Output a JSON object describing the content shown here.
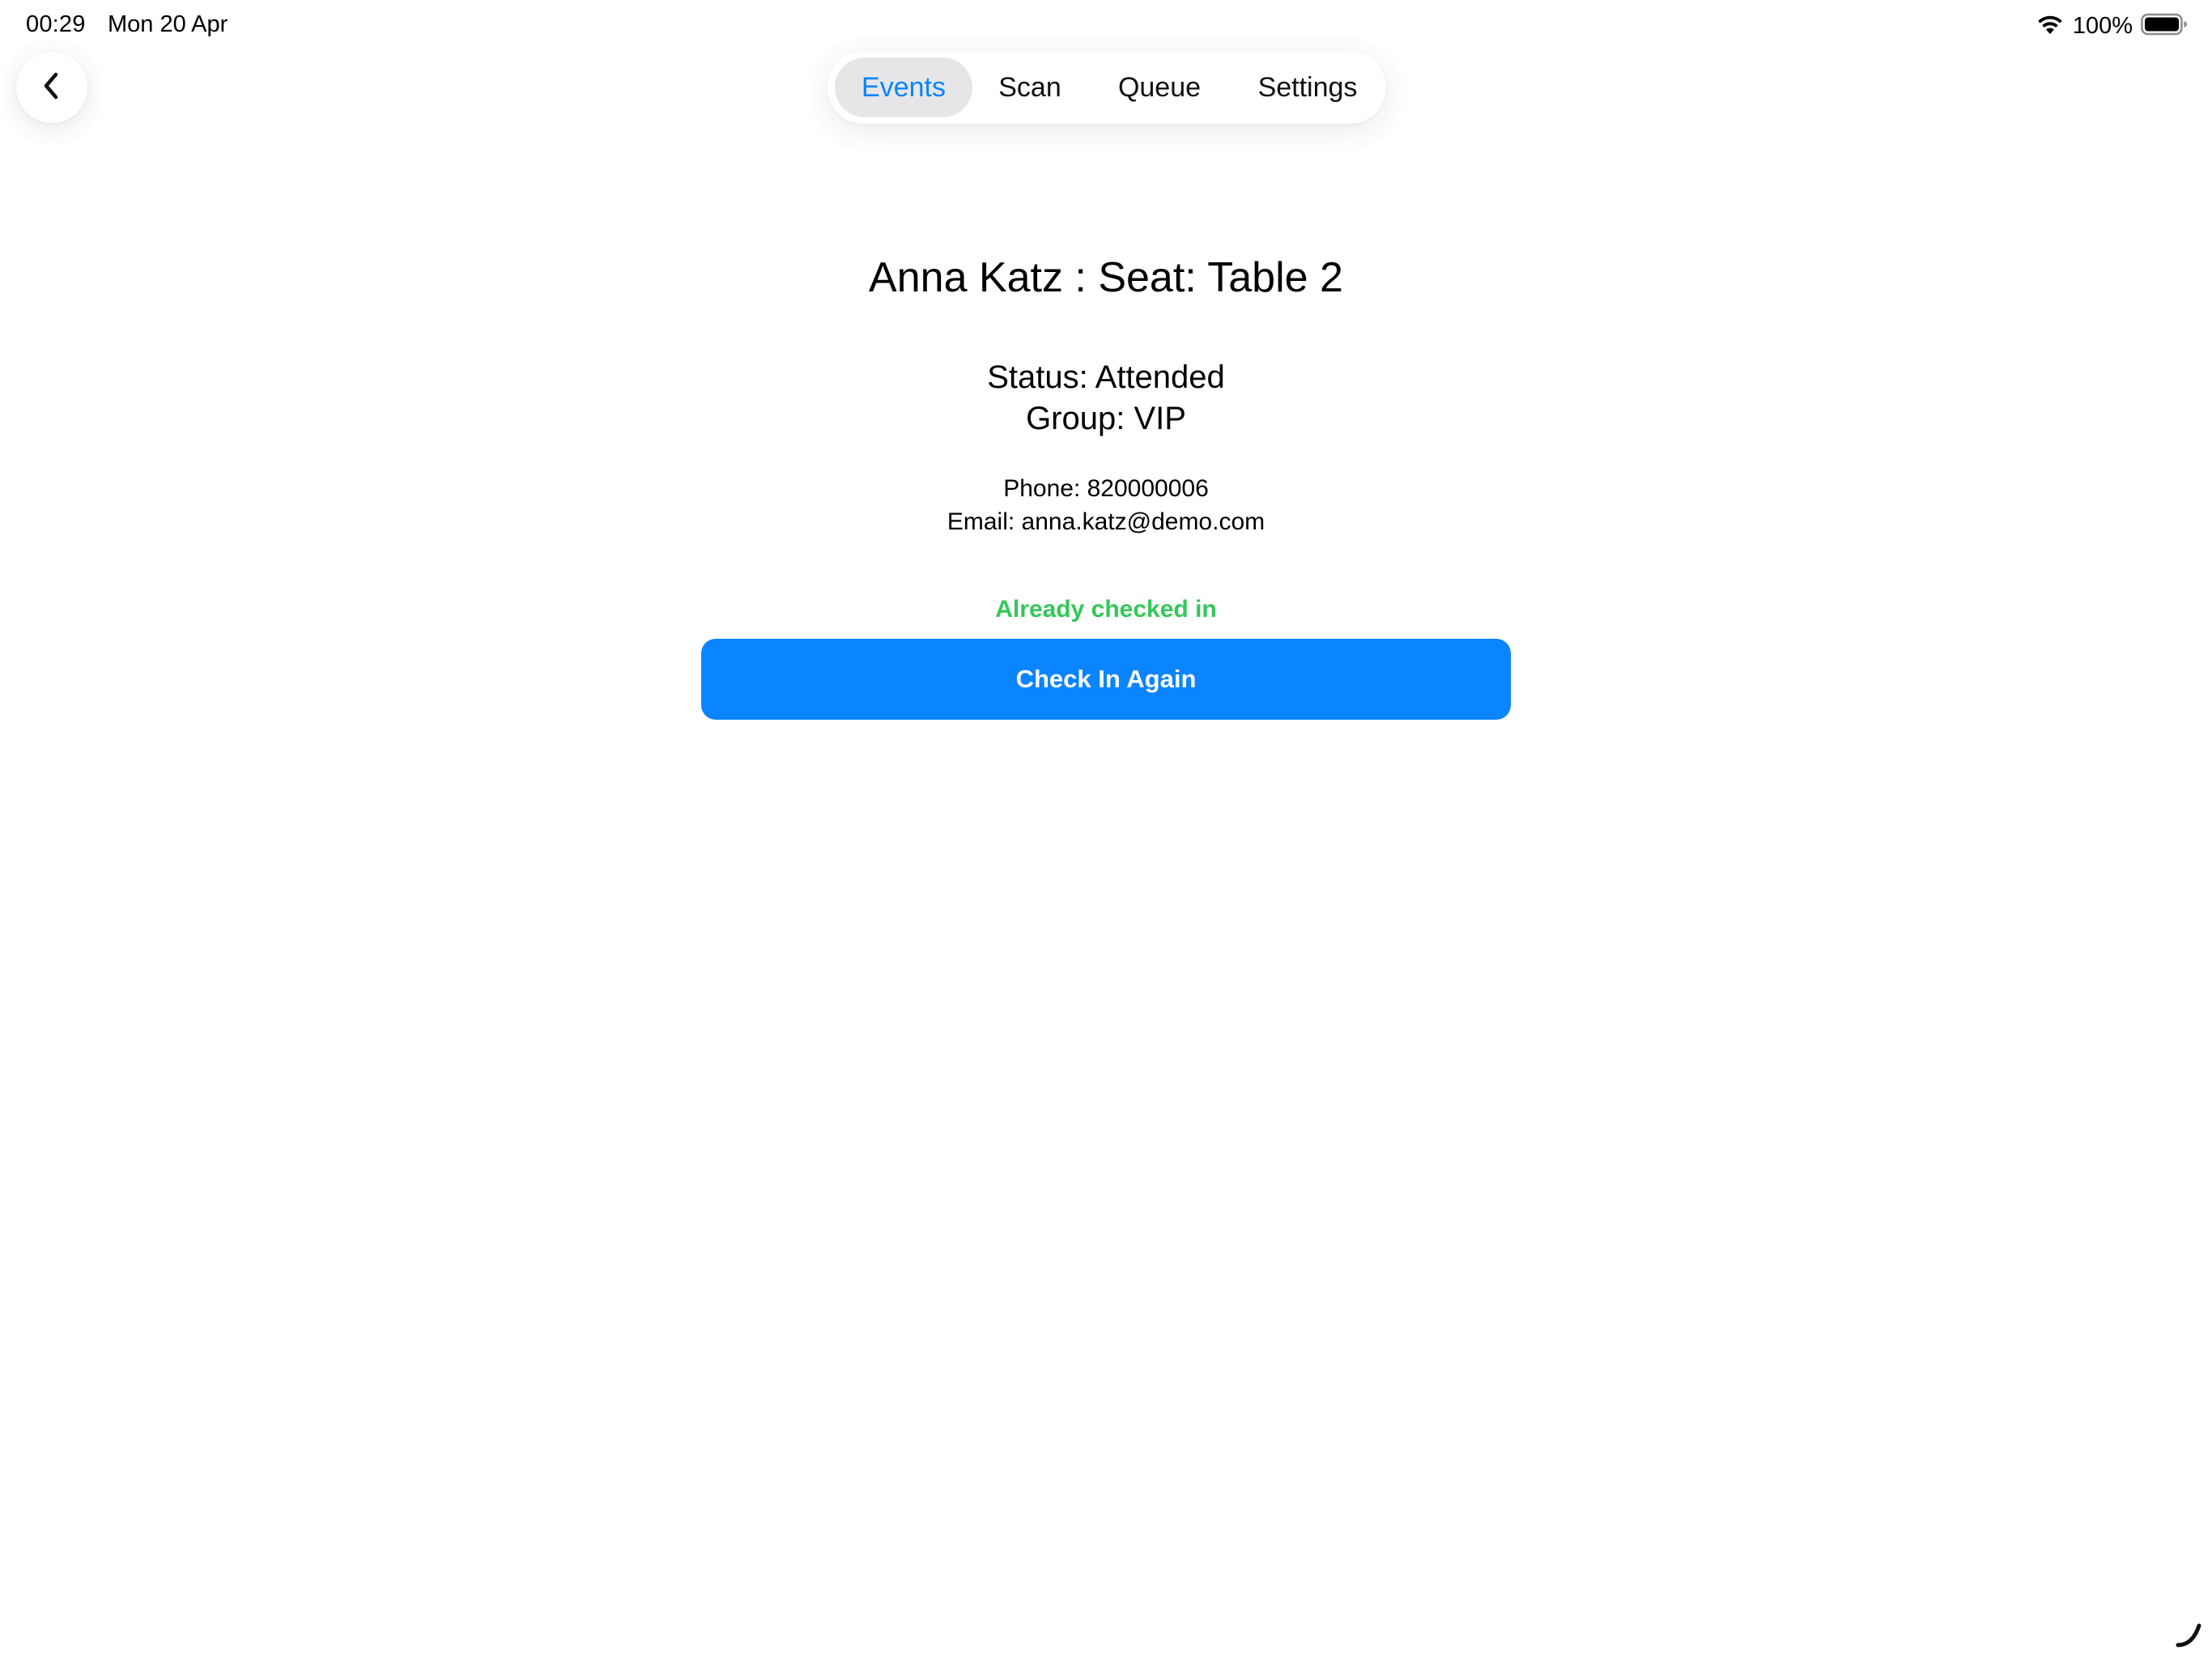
{
  "status_bar": {
    "time": "00:29",
    "date": "Mon 20 Apr",
    "battery_percent": "100%",
    "wifi_icon": "wifi-icon",
    "battery_icon": "battery-icon",
    "battery_level": 1.0
  },
  "nav": {
    "back_icon": "chevron-left-icon",
    "tabs": [
      {
        "label": "Events",
        "selected": true
      },
      {
        "label": "Scan",
        "selected": false
      },
      {
        "label": "Queue",
        "selected": false
      },
      {
        "label": "Settings",
        "selected": false
      }
    ]
  },
  "attendee": {
    "title": "Anna Katz : Seat: Table 2",
    "status": "Status: Attended",
    "group": "Group: VIP",
    "phone": "Phone: 820000006",
    "email": "Email: anna.katz@demo.com"
  },
  "checkin": {
    "message": "Already checked in",
    "button_label": "Check In Again"
  },
  "colors": {
    "accent": "#0a84ff",
    "success": "#34c759",
    "selected_tab_bg": "#e6e6e8"
  }
}
